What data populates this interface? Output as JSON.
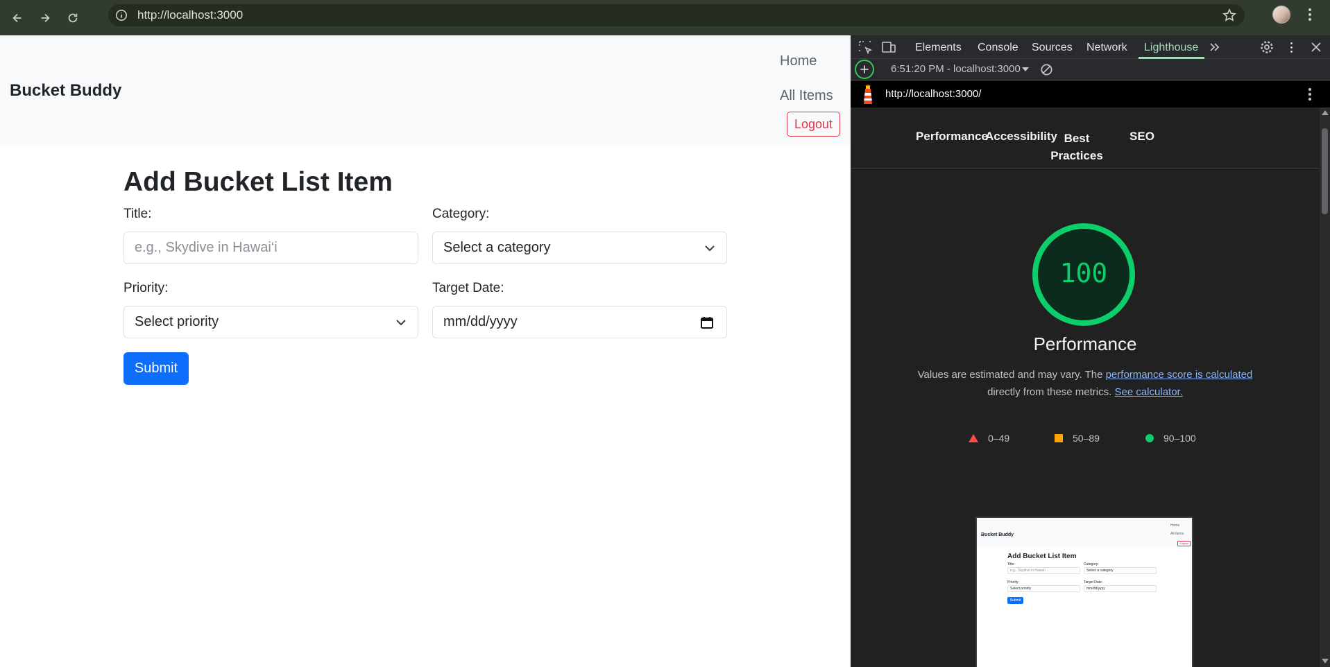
{
  "browser": {
    "url": "http://localhost:3000"
  },
  "navbar": {
    "brand": "Bucket Buddy",
    "home_label": "Home",
    "all_items_label": "All Items",
    "logout_label": "Logout"
  },
  "form": {
    "title": "Add Bucket List Item",
    "title_label": "Title:",
    "title_placeholder": "e.g., Skydive in Hawai‘i",
    "category_label": "Category:",
    "category_value": "Select a category",
    "priority_label": "Priority:",
    "priority_value": "Select priority",
    "date_label": "Target Date:",
    "date_value": "mm/dd/yyyy",
    "submit_label": "Submit"
  },
  "devtools": {
    "tabs": [
      "Elements",
      "Console",
      "Sources",
      "Network",
      "Lighthouse"
    ],
    "active_tab": "Lighthouse",
    "run_label": "6:51:20 PM - localhost:3000",
    "report_url": "http://localhost:3000/",
    "categories": [
      "Performance",
      "Accessibility",
      "Best Practices",
      "SEO"
    ],
    "score": "100",
    "score_title": "Performance",
    "note_prefix": "Values are estimated and may vary. The ",
    "note_link1": "performance score is calculated",
    "note_mid": "directly from these metrics.",
    "note_link2": "See calculator.",
    "legend": {
      "fail": "0–49",
      "average": "50–89",
      "pass": "90–100"
    },
    "colors": {
      "pass": "#0cce6b",
      "average": "#ffa400",
      "fail": "#ff4e42"
    }
  }
}
